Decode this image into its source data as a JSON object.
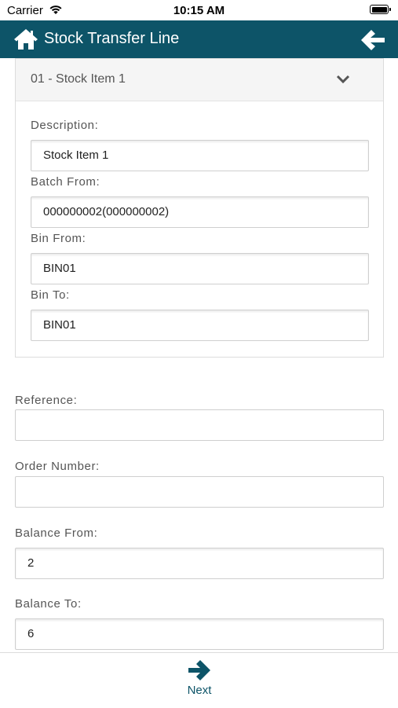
{
  "status": {
    "carrier": "Carrier",
    "time": "10:15 AM"
  },
  "header": {
    "title": "Stock Transfer Line"
  },
  "item": {
    "title": "01 - Stock Item 1",
    "description_label": "Description:",
    "description": "Stock Item 1",
    "batch_from_label": "Batch From:",
    "batch_from": "000000002(000000002)",
    "bin_from_label": "Bin From:",
    "bin_from": "BIN01",
    "bin_to_label": "Bin To:",
    "bin_to": "BIN01"
  },
  "form": {
    "reference_label": "Reference:",
    "reference": "",
    "order_number_label": "Order Number:",
    "order_number": "",
    "balance_from_label": "Balance From:",
    "balance_from": "2",
    "balance_to_label": "Balance To:",
    "balance_to": "6"
  },
  "footer": {
    "next_label": "Next"
  },
  "colors": {
    "primary": "#0d5468"
  }
}
